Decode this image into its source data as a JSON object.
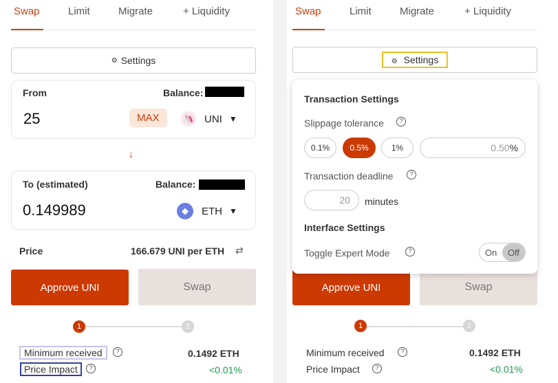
{
  "tabs": [
    "Swap",
    "Limit",
    "Migrate",
    "+ Liquidity"
  ],
  "settings": {
    "label": "Settings",
    "gear_icon": "gear-icon"
  },
  "from": {
    "label": "From",
    "balance_label": "Balance:",
    "amount": "25",
    "max": "MAX",
    "token": "UNI"
  },
  "to": {
    "label": "To (estimated)",
    "balance_label": "Balance:",
    "amount": "0.149989",
    "token": "ETH"
  },
  "price": {
    "label": "Price",
    "value": "166.679 UNI per ETH"
  },
  "buttons": {
    "approve": "Approve UNI",
    "swap": "Swap"
  },
  "steps": [
    "1",
    "2"
  ],
  "details": {
    "min_received_label": "Minimum received",
    "min_received_value": "0.1492 ETH",
    "price_impact_label": "Price Impact",
    "price_impact_value": "<0.01%"
  },
  "settings_panel": {
    "transaction_title": "Transaction Settings",
    "slippage_label": "Slippage tolerance",
    "slippage_options": [
      "0.1%",
      "0.5%",
      "1%"
    ],
    "slippage_selected": "0.5%",
    "slippage_custom_placeholder": "0.50",
    "slippage_unit": "%",
    "deadline_label": "Transaction deadline",
    "deadline_placeholder": "20",
    "deadline_unit": "minutes",
    "interface_title": "Interface Settings",
    "expert_label": "Toggle Expert Mode",
    "toggle_on": "On",
    "toggle_off": "Off"
  },
  "colors": {
    "accent": "#cc3a02",
    "positive": "#1a9c4a"
  }
}
